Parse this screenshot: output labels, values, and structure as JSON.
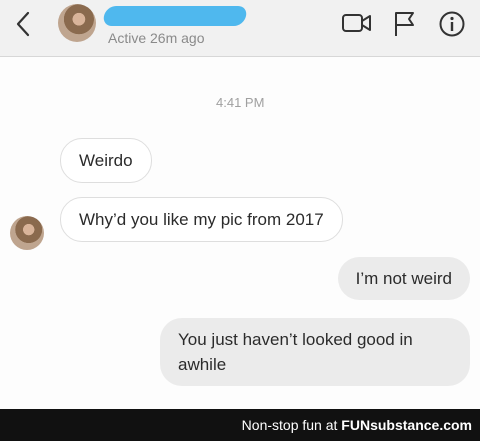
{
  "header": {
    "status": "Active 26m ago",
    "icons": [
      "back-arrow-icon",
      "video-camera-icon",
      "flag-icon",
      "info-icon"
    ]
  },
  "thread": {
    "timestamp": "4:41 PM",
    "messages": [
      {
        "from": "them",
        "text": "Weirdo"
      },
      {
        "from": "them",
        "text": "Why’d you like my pic from 2017"
      },
      {
        "from": "me",
        "text": "I’m not weird"
      },
      {
        "from": "me",
        "text": "You just haven’t looked good in awhile"
      }
    ]
  },
  "footer": {
    "text": "Non-stop fun at",
    "brand": "FUNsubstance.com"
  },
  "colors": {
    "redaction": "#4fb8ee",
    "outgoing_bubble": "#ebebeb",
    "incoming_bubble": "#ffffff"
  }
}
